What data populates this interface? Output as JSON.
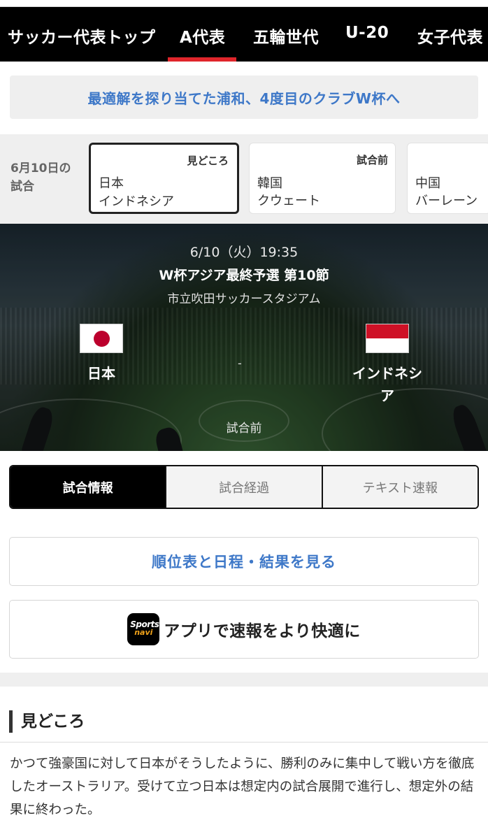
{
  "nav": {
    "tabs": [
      {
        "label": "サッカー代表トップ"
      },
      {
        "label": "A代表"
      },
      {
        "label": "五輪世代"
      },
      {
        "label": "U-20"
      },
      {
        "label": "女子代表"
      }
    ],
    "active_tab": "A代表",
    "accent_color": "#e0252b"
  },
  "headline": {
    "text": "最適解を探り当てた浦和、4度目のクラブW杯へ"
  },
  "matches_strip": {
    "date_label_line1": "6月10日の",
    "date_label_line2": "試合",
    "cards": [
      {
        "tag": "見どころ",
        "home": "日本",
        "away": "インドネシア",
        "selected": true
      },
      {
        "tag": "試合前",
        "home": "韓国",
        "away": "クウェート",
        "selected": false
      },
      {
        "tag": "",
        "home": "中国",
        "away": "バーレーン",
        "selected": false
      }
    ]
  },
  "match": {
    "datetime": "6/10（火）19:35",
    "competition": "W杯アジア最終予選 第10節",
    "venue": "市立吹田サッカースタジアム",
    "home": {
      "name": "日本",
      "flag_icon": "japan-flag-icon"
    },
    "away": {
      "name_line1": "インドネシ",
      "name_line2": "ア",
      "flag_icon": "indonesia-flag-icon"
    },
    "score": "-",
    "status": "試合前"
  },
  "info_tabs": [
    {
      "label": "試合情報",
      "active": true
    },
    {
      "label": "試合経過",
      "active": false
    },
    {
      "label": "テキスト速報",
      "active": false
    }
  ],
  "buttons": {
    "standings": "順位表と日程・結果を見る",
    "app_icon_line1": "Sports",
    "app_icon_line2": "navi",
    "app": "アプリで速報をより快適に"
  },
  "highlights": {
    "title": "見どころ",
    "body": "かつて強豪国に対して日本がそうしたように、勝利のみに集中して戦い方を徹底したオーストラリア。受けて立つ日本は想定内の試合展開で進行し、想定外の結果に終わった。"
  },
  "colors": {
    "link_blue": "#3e78c8",
    "strip_bg": "#efefef"
  }
}
